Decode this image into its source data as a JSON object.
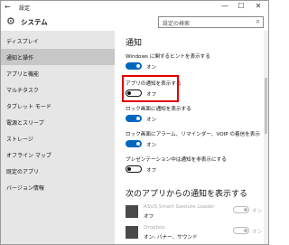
{
  "titlebar": {
    "title": "設定",
    "back": "←",
    "minimize": "—",
    "maximize": "☐",
    "close": "✕"
  },
  "header": {
    "title": "システム",
    "search_placeholder": "設定の検索"
  },
  "sidebar": {
    "items": [
      {
        "label": "ディスプレイ",
        "selected": false
      },
      {
        "label": "通知と操作",
        "selected": true
      },
      {
        "label": "アプリと機能",
        "selected": false
      },
      {
        "label": "マルチタスク",
        "selected": false
      },
      {
        "label": "タブレット モード",
        "selected": false
      },
      {
        "label": "電源とスリープ",
        "selected": false
      },
      {
        "label": "ストレージ",
        "selected": false
      },
      {
        "label": "オフライン マップ",
        "selected": false
      },
      {
        "label": "既定のアプリ",
        "selected": false
      },
      {
        "label": "バージョン情報",
        "selected": false
      }
    ]
  },
  "content": {
    "section_notifications": "通知",
    "settings": [
      {
        "label": "Windows に関するヒントを表示する",
        "state": "オン",
        "on": true
      },
      {
        "label": "アプリの通知を表示する",
        "state": "オフ",
        "on": false
      },
      {
        "label": "ロック画面に通知を表示する",
        "state": "オン",
        "on": true
      },
      {
        "label": "ロック画面にアラーム、リマインダー、VOIP の着信を表示",
        "state": "オン",
        "on": true
      },
      {
        "label": "プレゼンテーション中は通知を非表示にする",
        "state": "オフ",
        "on": false
      }
    ],
    "section_apps": "次のアプリからの通知を表示する",
    "apps": [
      {
        "name": "ASUS Smart Gesture Loader",
        "sub": "オフ",
        "toggle_state": "オン"
      },
      {
        "name": "Dropbox",
        "sub": "オン: バナー、サウンド",
        "toggle_state": "オン"
      }
    ]
  },
  "colors": {
    "accent": "#0067c0",
    "highlight": "#e00000",
    "sidebar_bg": "#e6e6e6",
    "sidebar_selected": "#c7c7c7"
  }
}
